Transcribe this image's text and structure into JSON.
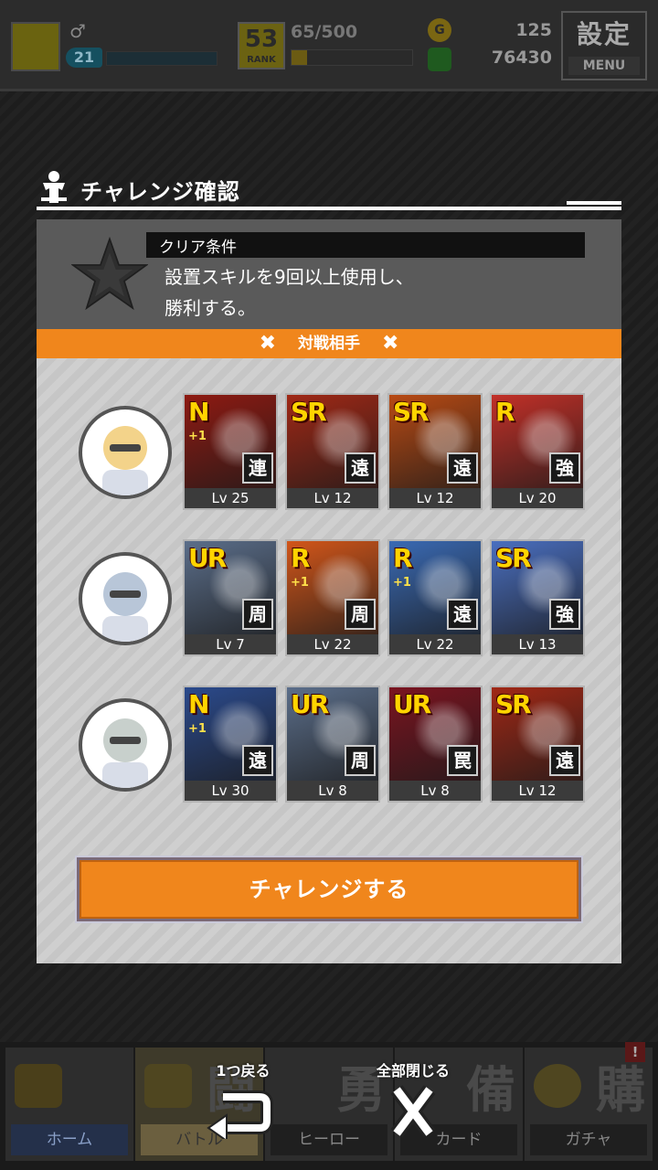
{
  "topbar": {
    "gender_symbol": "♂",
    "level": "21",
    "rank": "53",
    "rank_label": "RANK",
    "stamina": "65/500",
    "stamina_fraction": 0.13,
    "coins": "125",
    "money": "76430",
    "settings_kanji": "設定",
    "settings_menu": "MENU"
  },
  "modal": {
    "title": "チャレンジ確認",
    "condition_header": "クリア条件",
    "condition_line1": "設置スキルを9回以上使用し、",
    "condition_line2": "勝利する。",
    "opponent_banner": "対戦相手",
    "challenge_button": "チャレンジする"
  },
  "opponents": [
    {
      "cards": [
        {
          "rarity": "N",
          "plus": "+1",
          "type": "連",
          "level": "Lv 25",
          "art": "#8e1a12"
        },
        {
          "rarity": "SR",
          "plus": "",
          "type": "遠",
          "level": "Lv 12",
          "art": "#a02816"
        },
        {
          "rarity": "SR",
          "plus": "",
          "type": "遠",
          "level": "Lv 12",
          "art": "#b84a14"
        },
        {
          "rarity": "R",
          "plus": "",
          "type": "強",
          "level": "Lv 20",
          "art": "#c23028"
        }
      ]
    },
    {
      "cards": [
        {
          "rarity": "UR",
          "plus": "",
          "type": "周",
          "level": "Lv 7",
          "art": "#5b6e8a"
        },
        {
          "rarity": "R",
          "plus": "+1",
          "type": "周",
          "level": "Lv 22",
          "art": "#d2561a"
        },
        {
          "rarity": "R",
          "plus": "+1",
          "type": "遠",
          "level": "Lv 22",
          "art": "#3a6ab4"
        },
        {
          "rarity": "SR",
          "plus": "",
          "type": "強",
          "level": "Lv 13",
          "art": "#4a6fc0"
        }
      ]
    },
    {
      "cards": [
        {
          "rarity": "N",
          "plus": "+1",
          "type": "遠",
          "level": "Lv 30",
          "art": "#2b4a8c"
        },
        {
          "rarity": "UR",
          "plus": "",
          "type": "周",
          "level": "Lv 8",
          "art": "#5b6e8a"
        },
        {
          "rarity": "UR",
          "plus": "",
          "type": "罠",
          "level": "Lv 8",
          "art": "#7a1420"
        },
        {
          "rarity": "SR",
          "plus": "",
          "type": "遠",
          "level": "Lv 12",
          "art": "#a02816"
        }
      ]
    }
  ],
  "bottom_nav": [
    {
      "label": "ホーム",
      "kanji": ""
    },
    {
      "label": "バトル",
      "kanji": "闘"
    },
    {
      "label": "ヒーロー",
      "kanji": "勇"
    },
    {
      "label": "カード",
      "kanji": "備"
    },
    {
      "label": "ガチャ",
      "kanji": "購"
    }
  ],
  "nav_badge": "!",
  "float_buttons": {
    "back": "1つ戻る",
    "close_all": "全部閉じる"
  },
  "colors": {
    "accent_orange": "#f0861c",
    "rarity_N": "#ffd400",
    "rarity_R": "#ffd400",
    "rarity_SR": "#ffd400",
    "rarity_UR": "#ffd400"
  }
}
